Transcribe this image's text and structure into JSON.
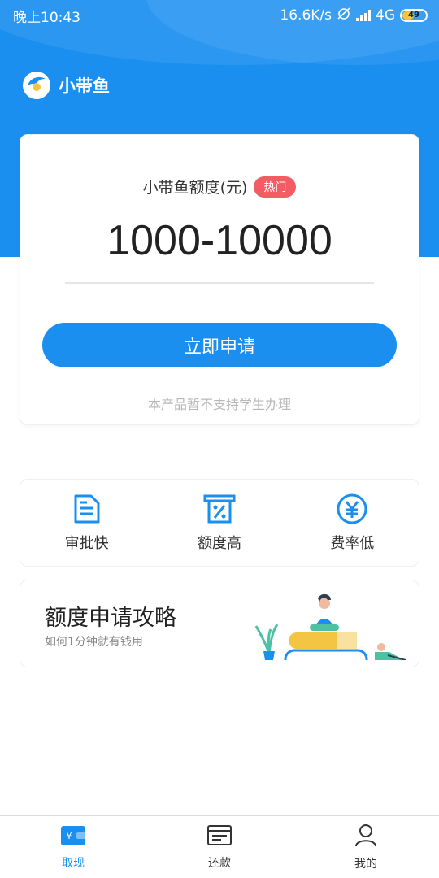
{
  "status_bar": {
    "time": "晚上10:43",
    "network_speed": "16.6K/s",
    "network_type": "4G",
    "battery": "49"
  },
  "brand": {
    "name": "小带鱼",
    "logo_icon": "fish-logo-icon"
  },
  "quota_card": {
    "title": "小带鱼额度(元)",
    "badge": "热门",
    "amount": "1000-10000",
    "apply_button": "立即申请",
    "note": "本产品暂不支持学生办理"
  },
  "features": [
    {
      "label": "审批快",
      "icon": "document-icon"
    },
    {
      "label": "额度高",
      "icon": "percent-icon"
    },
    {
      "label": "费率低",
      "icon": "yen-icon"
    }
  ],
  "guide": {
    "title": "额度申请攻略",
    "subtitle": "如何1分钟就有钱用"
  },
  "tabs": [
    {
      "label": "取现",
      "icon": "wallet-icon",
      "active": true
    },
    {
      "label": "还款",
      "icon": "bill-icon",
      "active": false
    },
    {
      "label": "我的",
      "icon": "user-icon",
      "active": false
    }
  ],
  "colors": {
    "primary": "#1b8ff0",
    "badge": "#f45c63"
  }
}
